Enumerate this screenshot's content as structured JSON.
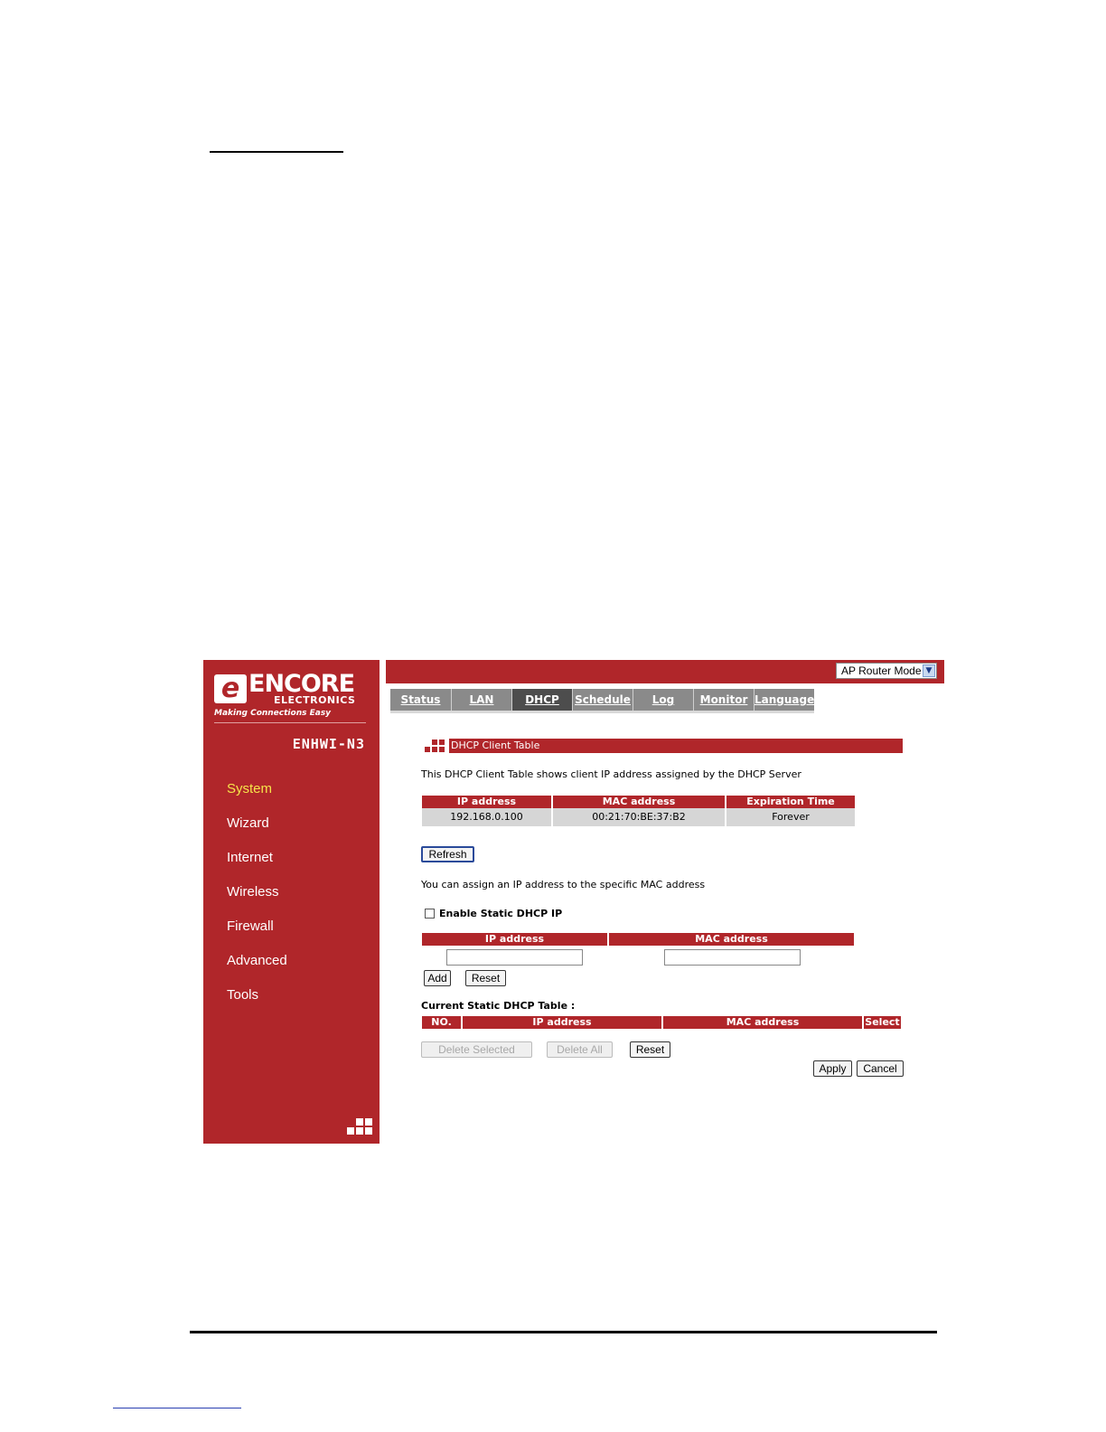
{
  "sidebar": {
    "logo": {
      "letter": "e",
      "name": "ENCORE",
      "sub": "ELECTRONICS",
      "tagline": "Making Connections Easy"
    },
    "model": "ENHWI-N3",
    "items": [
      {
        "label": "System",
        "active": true
      },
      {
        "label": "Wizard"
      },
      {
        "label": "Internet"
      },
      {
        "label": "Wireless"
      },
      {
        "label": "Firewall"
      },
      {
        "label": "Advanced"
      },
      {
        "label": "Tools"
      }
    ]
  },
  "header": {
    "mode_select": {
      "value": "AP Router Mode",
      "arrow_icon": "chevron-down-icon"
    }
  },
  "tabs": [
    {
      "label": "Status"
    },
    {
      "label": "LAN"
    },
    {
      "label": "DHCP",
      "active": true
    },
    {
      "label": "Schedule"
    },
    {
      "label": "Log"
    },
    {
      "label": "Monitor"
    },
    {
      "label": "Language"
    }
  ],
  "client_table": {
    "title": "DHCP Client Table",
    "description": "This DHCP Client Table shows client IP address assigned by the DHCP Server",
    "columns": [
      "IP address",
      "MAC address",
      "Expiration Time"
    ],
    "rows": [
      [
        "192.168.0.100",
        "00:21:70:BE:37:B2",
        "Forever"
      ]
    ],
    "refresh_label": "Refresh"
  },
  "static": {
    "description": "You can assign an IP address to the specific MAC address",
    "enable_label": "Enable Static DHCP IP",
    "enabled": false,
    "columns": [
      "IP address",
      "MAC address"
    ],
    "ip_value": "",
    "mac_value": "",
    "add_label": "Add",
    "reset_label": "Reset"
  },
  "current_table": {
    "title": "Current Static DHCP Table :",
    "columns": [
      "NO.",
      "IP address",
      "MAC address",
      "Select"
    ],
    "delete_selected_label": "Delete Selected",
    "delete_all_label": "Delete All",
    "reset_label": "Reset"
  },
  "footer": {
    "apply_label": "Apply",
    "cancel_label": "Cancel"
  },
  "colors": {
    "brand_red": "#b0262a",
    "tab_gray": "#8a8a8a",
    "tab_active": "#4d4d4d",
    "active_nav": "#f6e44a"
  }
}
